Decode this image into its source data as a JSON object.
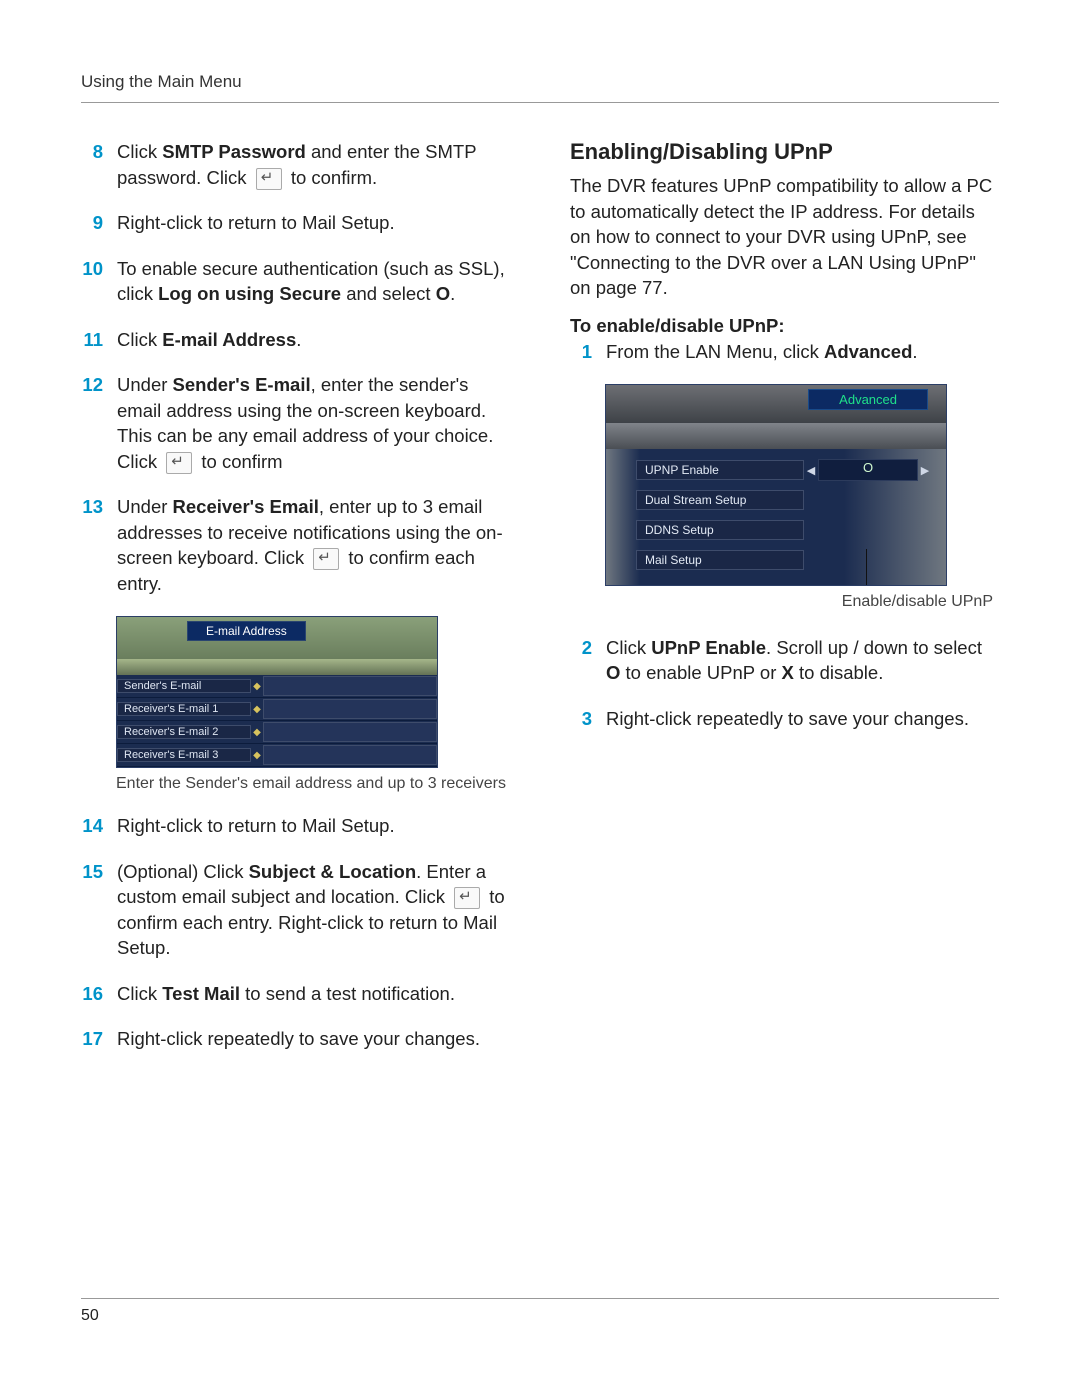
{
  "running_head": "Using the Main Menu",
  "page_number": "50",
  "icons": {
    "enter": "enter-key-icon"
  },
  "left": {
    "steps": {
      "8": {
        "num": "8",
        "a": "Click ",
        "b": "SMTP Password",
        "c": " and enter the SMTP password. Click ",
        "d": " to confirm."
      },
      "9": {
        "num": "9",
        "a": "Right-click to return to Mail Setup."
      },
      "10": {
        "num": "10",
        "a": "To enable secure authentication (such as SSL), click ",
        "b": "Log on using Secure",
        "c": " and select ",
        "d": "O",
        "e": "."
      },
      "11": {
        "num": "11",
        "a": "Click ",
        "b": "E-mail Address",
        "c": "."
      },
      "12": {
        "num": "12",
        "a": "Under ",
        "b": "Sender's E-mail",
        "c": ", enter the sender's email address using the on-screen keyboard. This can be any email address of your choice. Click ",
        "d": " to confirm"
      },
      "13": {
        "num": "13",
        "a": "Under ",
        "b": "Receiver's Email",
        "c": ", enter up to 3 email addresses to receive notifications using the on-screen keyboard. Click ",
        "d": " to confirm each entry."
      },
      "14": {
        "num": "14",
        "a": "Right-click to return to Mail Setup."
      },
      "15": {
        "num": "15",
        "a": "(Optional) Click ",
        "b": "Subject & Location",
        "c": ". Enter a custom email subject and location. Click ",
        "d": " to confirm each entry. Right-click to return to Mail Setup."
      },
      "16": {
        "num": "16",
        "a": "Click ",
        "b": "Test Mail",
        "c": " to send a test notification."
      },
      "17": {
        "num": "17",
        "a": "Right-click repeatedly to save your changes."
      }
    },
    "fig_email": {
      "title": "E-mail Address",
      "rows": [
        "Sender's E-mail",
        "Receiver's E-mail 1",
        "Receiver's E-mail 2",
        "Receiver's E-mail 3"
      ],
      "caption": "Enter the Sender's email address and up to 3 receivers"
    }
  },
  "right": {
    "h2": "Enabling/Disabling UPnP",
    "intro": "The DVR features UPnP compatibility to allow a PC to automatically detect the IP address. For details on how to connect to your DVR using UPnP, see \"Connecting to the DVR over a LAN Using UPnP\" on page 77.",
    "subhead": "To enable/disable UPnP:",
    "steps": {
      "1": {
        "num": "1",
        "a": "From the LAN Menu, click ",
        "b": "Advanced",
        "c": "."
      },
      "2": {
        "num": "2",
        "a": "Click ",
        "b": "UPnP Enable",
        "c": ". Scroll up / down to select ",
        "d": "O",
        "e": " to enable UPnP or ",
        "f": "X",
        "g": " to disable."
      },
      "3": {
        "num": "3",
        "a": "Right-click repeatedly to save your changes."
      }
    },
    "fig_adv": {
      "title": "Advanced",
      "rows": [
        {
          "label": "UPNP Enable",
          "value": "O"
        },
        {
          "label": "Dual Stream Setup",
          "value": ""
        },
        {
          "label": "DDNS Setup",
          "value": ""
        },
        {
          "label": "Mail Setup",
          "value": ""
        }
      ],
      "caption": "Enable/disable UPnP"
    }
  }
}
